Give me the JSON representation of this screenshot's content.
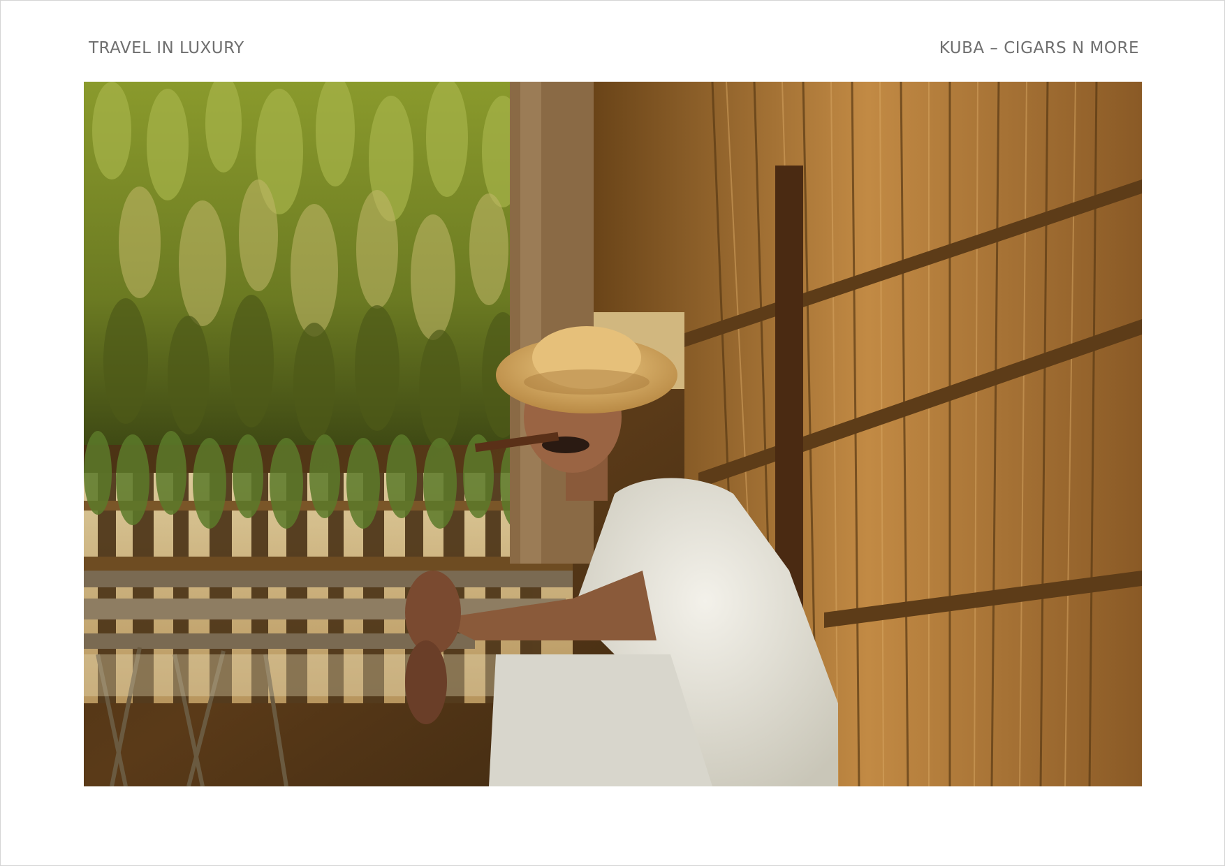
{
  "header": {
    "left_title": "TRAVEL IN LUXURY",
    "right_title": "KUBA – CIGARS N MORE"
  },
  "photo": {
    "subject_icon": "tobacco-barn-photo",
    "colors": {
      "tobacco_leaf": "#7d8b2e",
      "thatch": "#b07a3a",
      "shirt": "#e8e6dc",
      "hat": "#d8b06a"
    }
  }
}
